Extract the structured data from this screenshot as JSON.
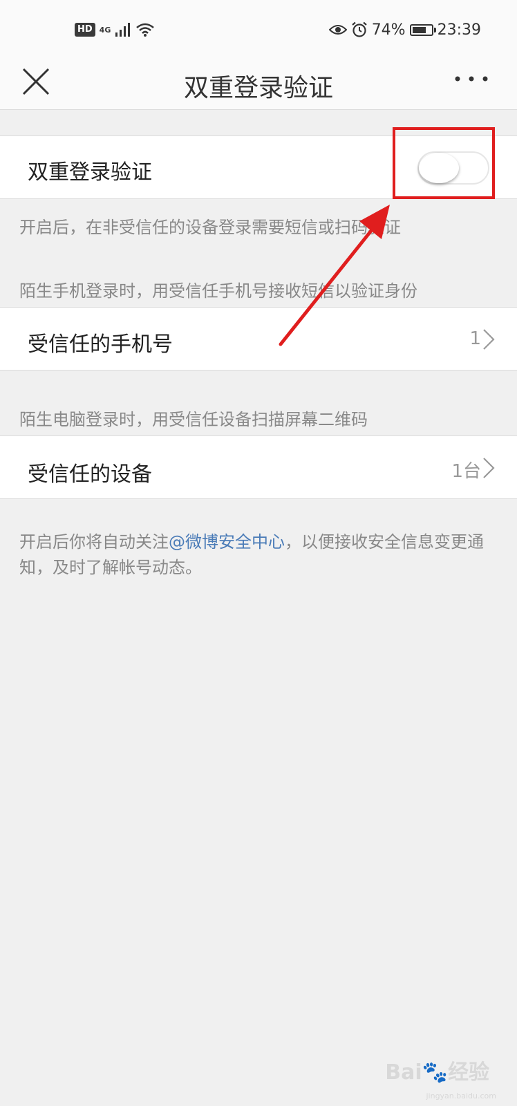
{
  "status_bar": {
    "hd": "HD",
    "network": "4G",
    "battery_percent": "74%",
    "battery_level": 0.74,
    "time": "23:39",
    "icons": [
      "signal-icon",
      "wifi-icon",
      "eye-icon",
      "alarm-icon",
      "battery-icon"
    ]
  },
  "nav": {
    "title": "双重登录验证",
    "close_icon": "close-icon",
    "more_icon": "more-icon"
  },
  "two_factor": {
    "label": "双重登录验证",
    "toggle_on": false,
    "description": "开启后，在非受信任的设备登录需要短信或扫码验证"
  },
  "trusted_phone": {
    "hint": "陌生手机登录时，用受信任手机号接收短信以验证身份",
    "label": "受信任的手机号",
    "value": "1"
  },
  "trusted_device": {
    "hint": "陌生电脑登录时，用受信任设备扫描屏幕二维码",
    "label": "受信任的设备",
    "value": "1台"
  },
  "footer_note": {
    "prefix": "开启后你将自动关注",
    "link": "@微博安全中心",
    "suffix": "，以便接收安全信息变更通知，及时了解帐号动态。"
  },
  "watermark": {
    "logo": "Bai",
    "text": "经验",
    "url": "jingyan.baidu.com"
  },
  "colors": {
    "background": "#f0f0f0",
    "link": "#4a7bb7",
    "annotation": "#e01e1e"
  }
}
